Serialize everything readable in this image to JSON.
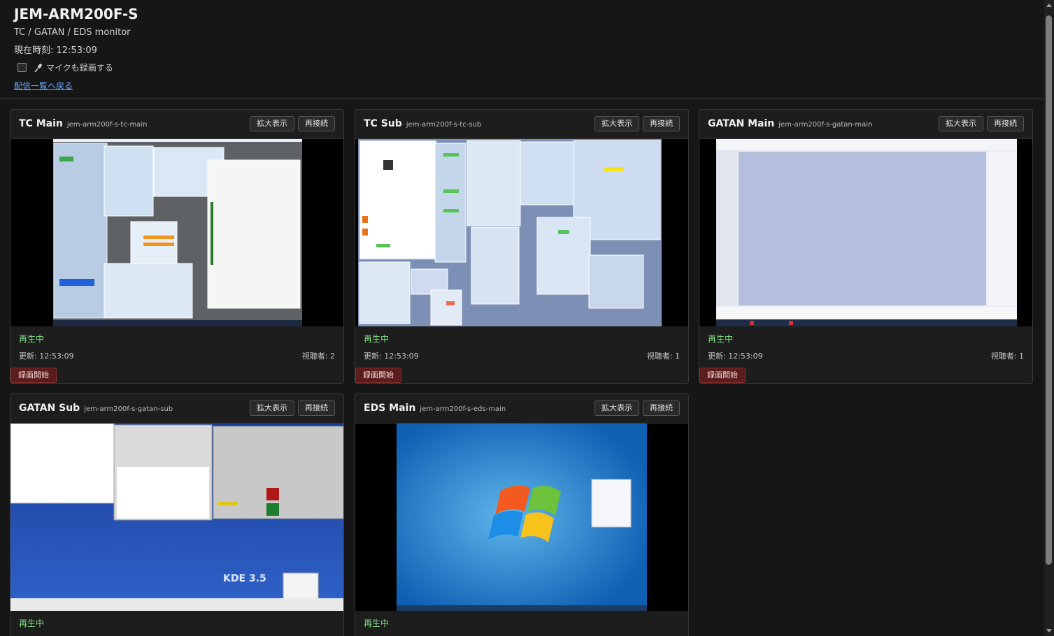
{
  "header": {
    "title": "JEM-ARM200F-S",
    "subtitle": "TC / GATAN / EDS monitor",
    "clock_label": "現在時刻: 12:53:09",
    "mic_label": "マイクも録画する",
    "back_link": "配信一覧へ戻る"
  },
  "cards": [
    {
      "title": "TC Main",
      "slug": "jem-arm200f-s-tc-main",
      "zoom": "拡大表示",
      "reconnect": "再接続",
      "status": "再生中",
      "updated": "更新: 12:53:09",
      "viewers": "視聴者: 2",
      "record": "録画開始"
    },
    {
      "title": "TC Sub",
      "slug": "jem-arm200f-s-tc-sub",
      "zoom": "拡大表示",
      "reconnect": "再接続",
      "status": "再生中",
      "updated": "更新: 12:53:09",
      "viewers": "視聴者: 1",
      "record": "録画開始"
    },
    {
      "title": "GATAN Main",
      "slug": "jem-arm200f-s-gatan-main",
      "zoom": "拡大表示",
      "reconnect": "再接続",
      "status": "再生中",
      "updated": "更新: 12:53:09",
      "viewers": "視聴者: 1",
      "record": "録画開始"
    },
    {
      "title": "GATAN Sub",
      "slug": "jem-arm200f-s-gatan-sub",
      "zoom": "拡大表示",
      "reconnect": "再接続",
      "status": "再生中"
    },
    {
      "title": "EDS Main",
      "slug": "jem-arm200f-s-eds-main",
      "zoom": "拡大表示",
      "reconnect": "再接続",
      "status": "再生中"
    }
  ],
  "colors": {
    "background": "#161616",
    "card": "#1d1d1d",
    "status_green": "#7fe07f",
    "link_blue": "#6aa7ff",
    "record_red": "#5a1c1c"
  }
}
